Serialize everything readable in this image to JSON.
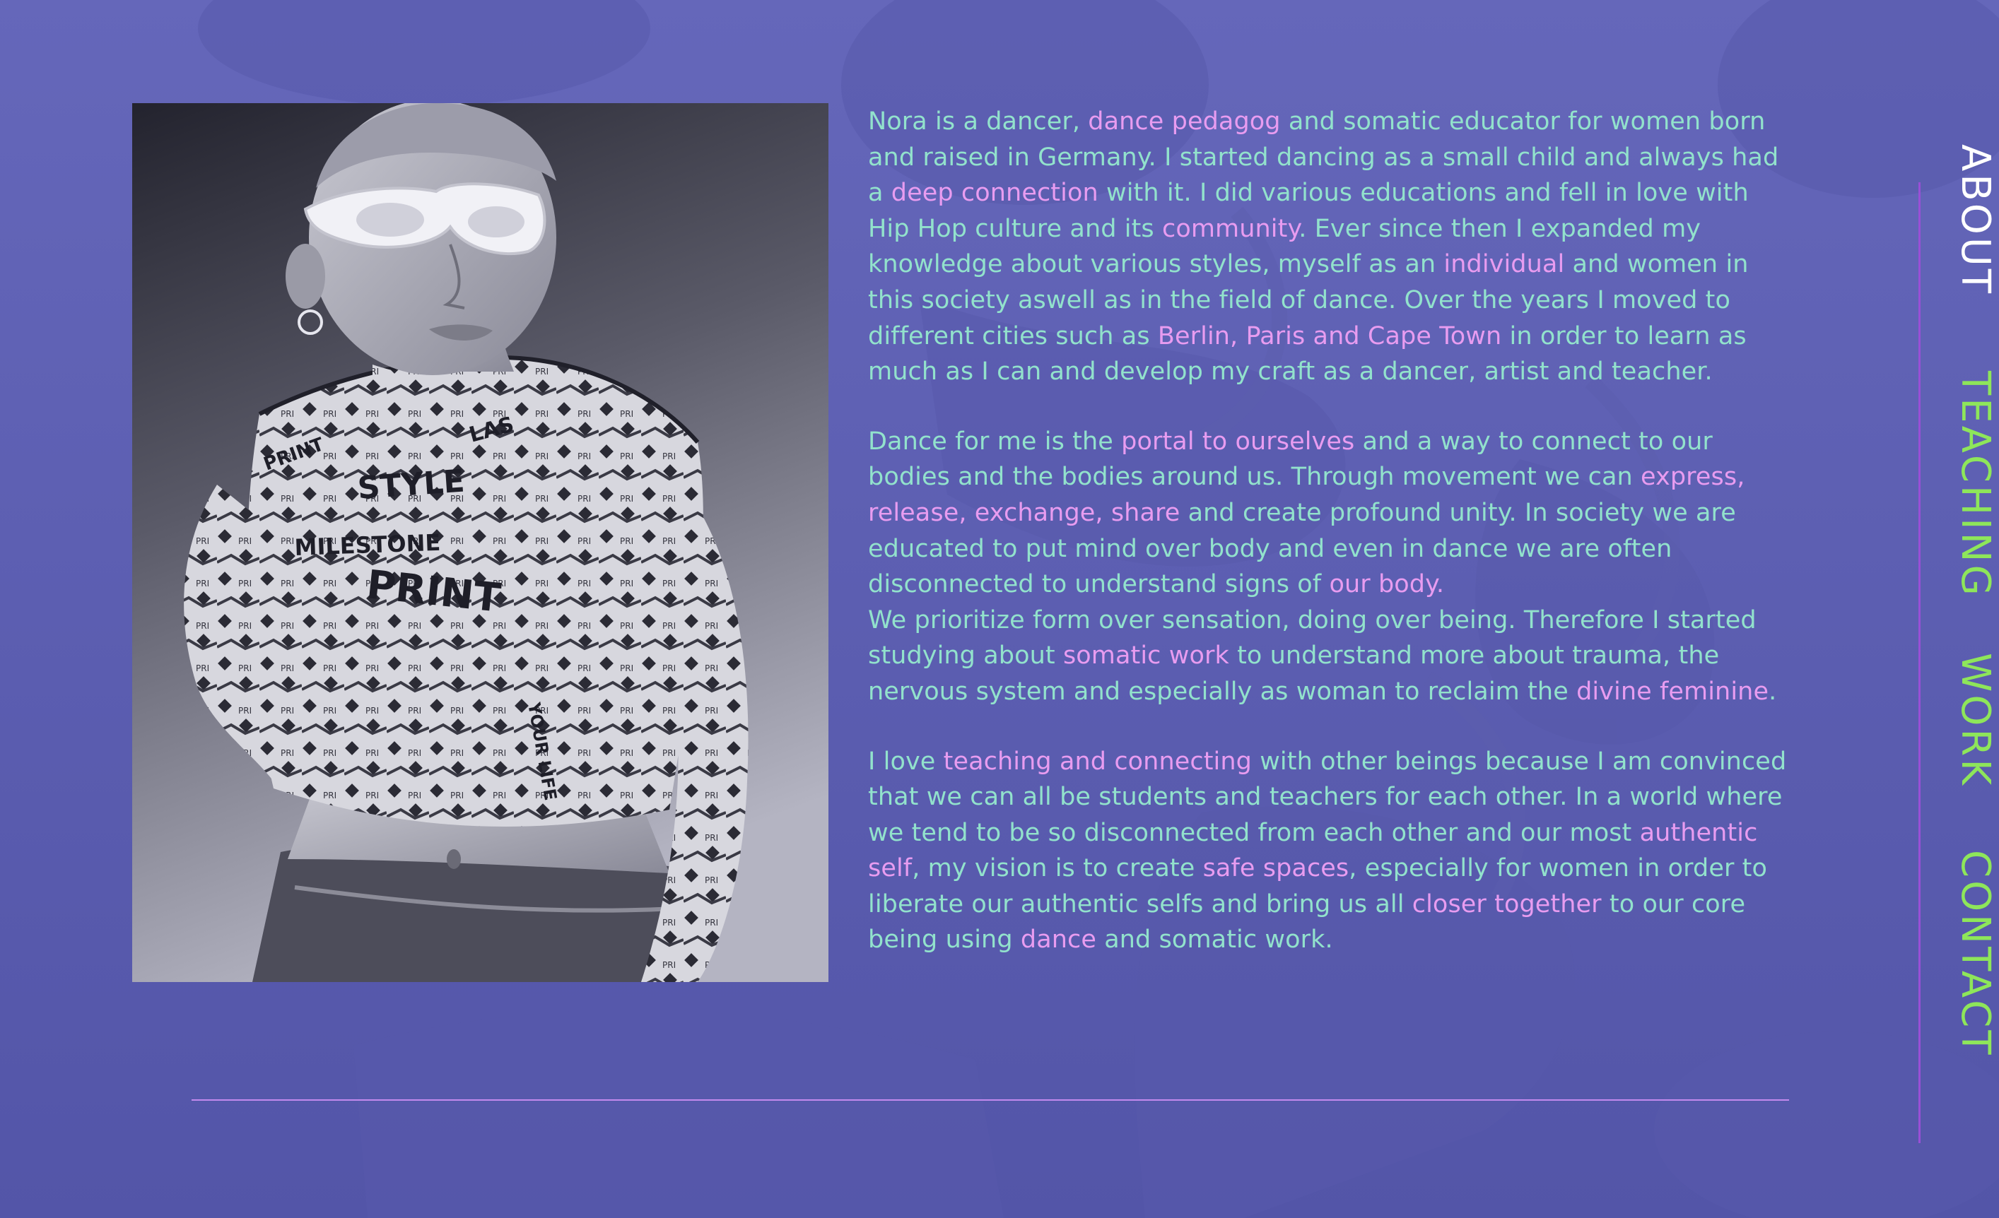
{
  "about": {
    "paragraphs": [
      [
        {
          "t": "Nora is a dancer, ",
          "h": false
        },
        {
          "t": "dance pedagog",
          "h": true
        },
        {
          "t": " and somatic educator for women born and raised in Germany. I started dancing as a small child and always had a ",
          "h": false
        },
        {
          "t": "deep connection",
          "h": true
        },
        {
          "t": " with it. I did various educations and fell in love with Hip Hop culture and its ",
          "h": false
        },
        {
          "t": "community",
          "h": true
        },
        {
          "t": ". Ever since then I expanded my knowledge about various styles, myself as an ",
          "h": false
        },
        {
          "t": "individual",
          "h": true
        },
        {
          "t": " and women in this society aswell as in the field of dance. Over the years I moved to different cities such as ",
          "h": false
        },
        {
          "t": "Berlin, Paris and Cape Town",
          "h": true
        },
        {
          "t": " in order to learn as much as I can and develop my craft as a dancer, artist and teacher.",
          "h": false
        }
      ],
      [
        {
          "t": "Dance for me is the ",
          "h": false
        },
        {
          "t": "portal to ourselves",
          "h": true
        },
        {
          "t": " and a way to connect to our bodies and the bodies around us. Through movement we can ",
          "h": false
        },
        {
          "t": "express, release, exchange, share",
          "h": true
        },
        {
          "t": " and create profound unity. In society we are educated to put mind over body and even in dance we are often disconnected to understand signs of ",
          "h": false
        },
        {
          "t": "our body.",
          "h": true
        }
      ],
      [
        {
          "t": "We prioritize form over sensation, doing over being. Therefore I started studying about ",
          "h": false
        },
        {
          "t": "somatic work",
          "h": true
        },
        {
          "t": " to understand more about trauma, the nervous system and especially as woman to reclaim the ",
          "h": false
        },
        {
          "t": "divine feminine",
          "h": true
        },
        {
          "t": ".",
          "h": false
        }
      ],
      [
        {
          "t": "I love ",
          "h": false
        },
        {
          "t": "teaching and connecting",
          "h": true
        },
        {
          "t": " with other beings because I am convinced that we can all be students and teachers for each other. In a world where we tend to be so disconnected from each other and our most ",
          "h": false
        },
        {
          "t": "authentic self",
          "h": true
        },
        {
          "t": ", my vision is to create ",
          "h": false
        },
        {
          "t": "safe spaces",
          "h": true
        },
        {
          "t": ", especially for women in order to liberate our authentic selfs and bring us all ",
          "h": false
        },
        {
          "t": "closer together",
          "h": true
        },
        {
          "t": " to our core being using ",
          "h": false
        },
        {
          "t": "dance",
          "h": true
        },
        {
          "t": " and somatic work.",
          "h": false
        }
      ]
    ]
  },
  "nav": {
    "about": "ABOUT",
    "teaching": "TEACHING",
    "work": "WORK",
    "contact": "CONTACT",
    "active": "about"
  },
  "colors": {
    "background": "#6163b8",
    "body_text": "#92e2cc",
    "highlight_text": "#e89cf0",
    "nav_active": "#ffffff",
    "nav_inactive": "#8ee65a",
    "rail": "#9a4fd6",
    "divider": "#c38aee"
  },
  "images": {
    "portrait": "black-and-white portrait of a dancer with shaved head, white sunglasses, printed crop top and jeans"
  }
}
